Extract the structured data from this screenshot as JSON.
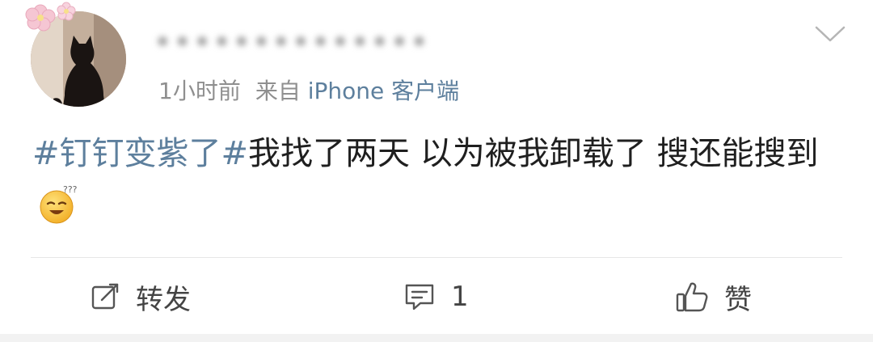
{
  "post": {
    "username_obscured": "••••••••••••••",
    "time": "1小时前",
    "source_prefix": "来自",
    "source": "iPhone 客户端",
    "content": {
      "topic": "#钉钉变紫了#",
      "text": "我找了两天 以为被我卸载了 搜还能搜到"
    }
  },
  "actions": {
    "repost_label": "转发",
    "comment_count": "1",
    "like_label": "赞"
  },
  "colors": {
    "link": "#5d7f9d",
    "meta": "#8f8f8f",
    "text": "#1f1f1f"
  },
  "icons": [
    "avatar-cat-silhouette",
    "chevron-down-icon",
    "emoji-sleepy-face",
    "repost-icon",
    "comment-icon",
    "thumbs-up-icon"
  ]
}
